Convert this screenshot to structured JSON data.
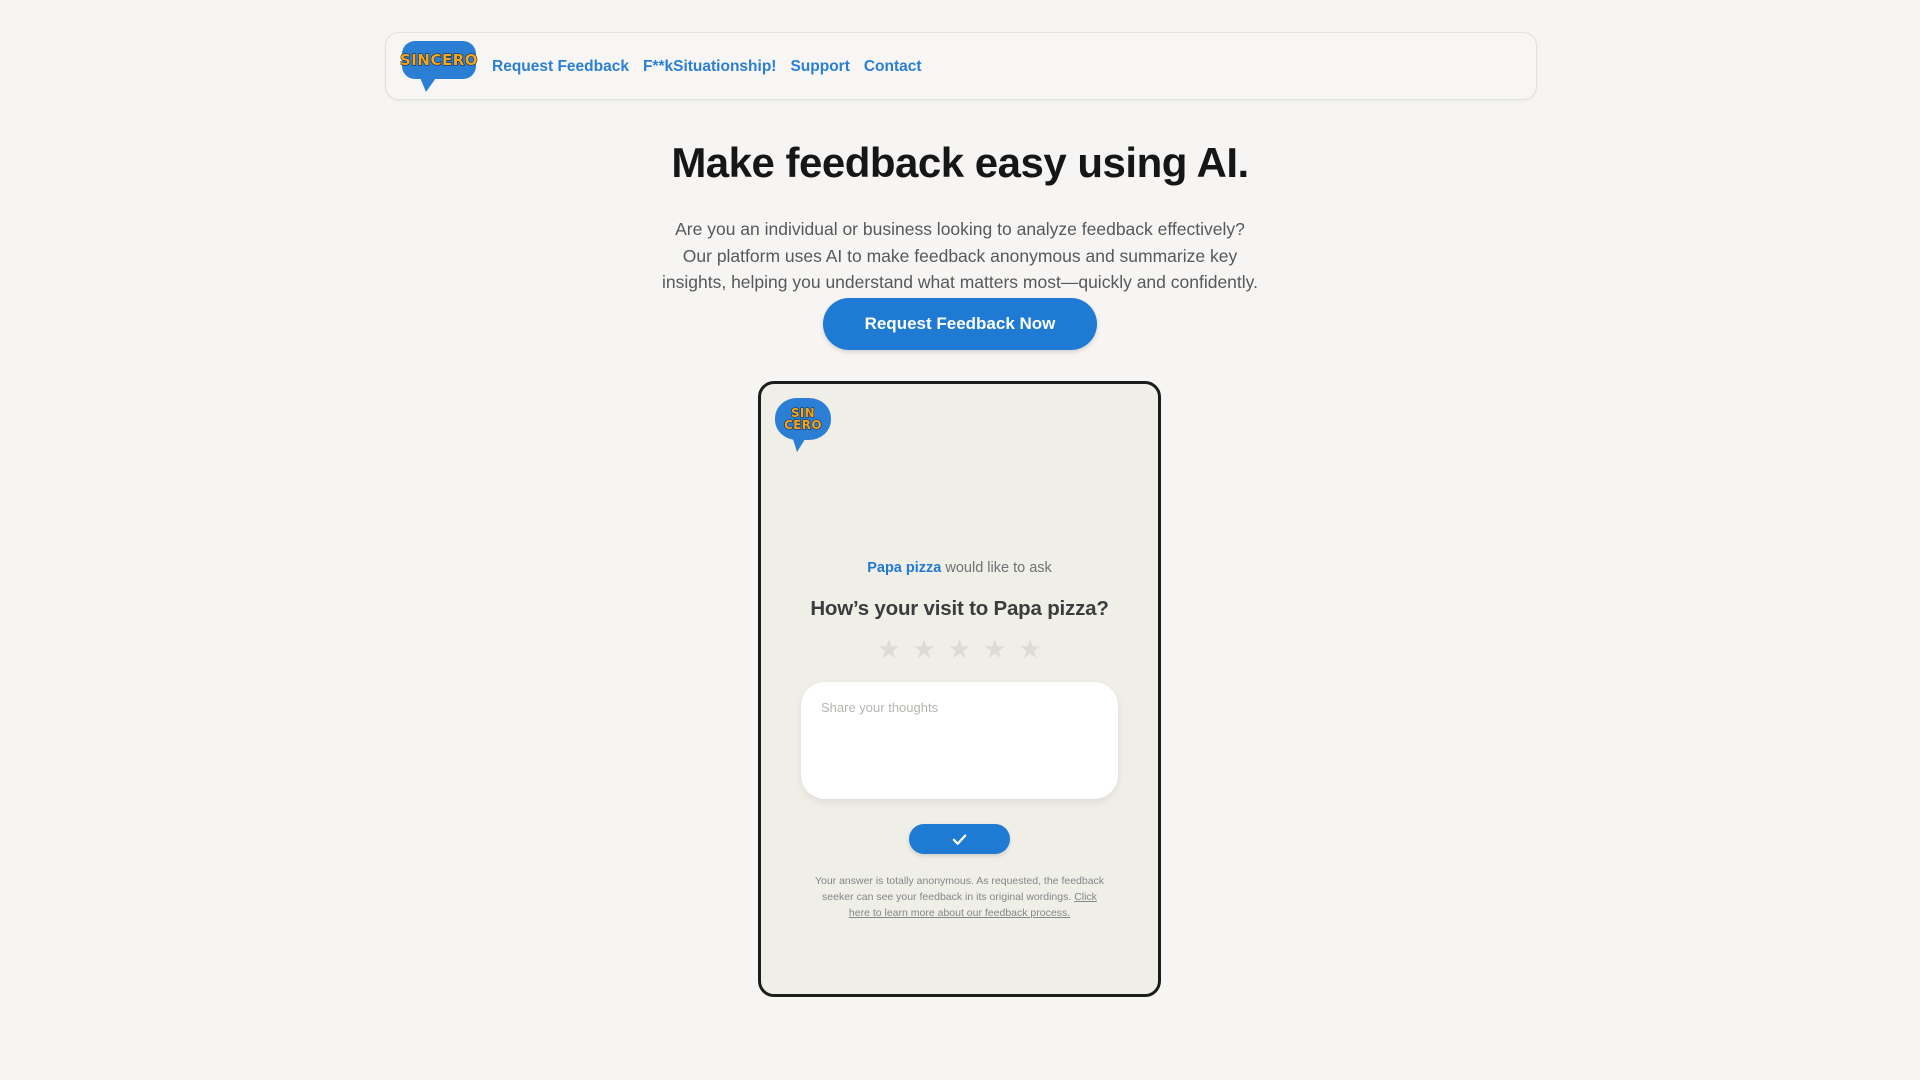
{
  "header": {
    "logo": {
      "icon": "speech-bubble-logo",
      "text": "SINCERO"
    },
    "nav": [
      {
        "label": "Request Feedback"
      },
      {
        "label": "F**kSituationship!"
      },
      {
        "label": "Support"
      },
      {
        "label": "Contact"
      }
    ]
  },
  "hero": {
    "title": "Make feedback easy using AI.",
    "subtitle": "Are you an individual or business looking to analyze feedback effectively? Our platform uses AI to make feedback anonymous and summarize key insights, helping you understand what matters most—quickly and confidently.",
    "cta_label": "Request Feedback Now"
  },
  "preview": {
    "logo": {
      "icon": "speech-bubble-logo",
      "line1": "SIN",
      "line2": "CERO"
    },
    "asker_name": "Papa pizza",
    "asker_suffix": " would like to ask",
    "question": "How’s your visit to Papa pizza?",
    "rating": {
      "icon": "star-icon",
      "glyph": "★",
      "count": 5,
      "selected": 0
    },
    "answer": {
      "value": "",
      "placeholder": "Share your thoughts"
    },
    "submit": {
      "icon": "check-icon",
      "label": ""
    },
    "disclaimer_text": "Your answer is totally anonymous. As requested, the feedback seeker can see your feedback in its original wordings. ",
    "disclaimer_link": "Click here to learn more about our feedback process."
  },
  "colors": {
    "accent_blue": "#1f7ad4",
    "logo_blue": "#2a7fd4",
    "logo_orange": "#f5a623",
    "page_bg": "#f6f5f3",
    "card_bg": "#efeee7",
    "card_border": "#1c1c1c",
    "star_empty": "#dcdbd6"
  }
}
